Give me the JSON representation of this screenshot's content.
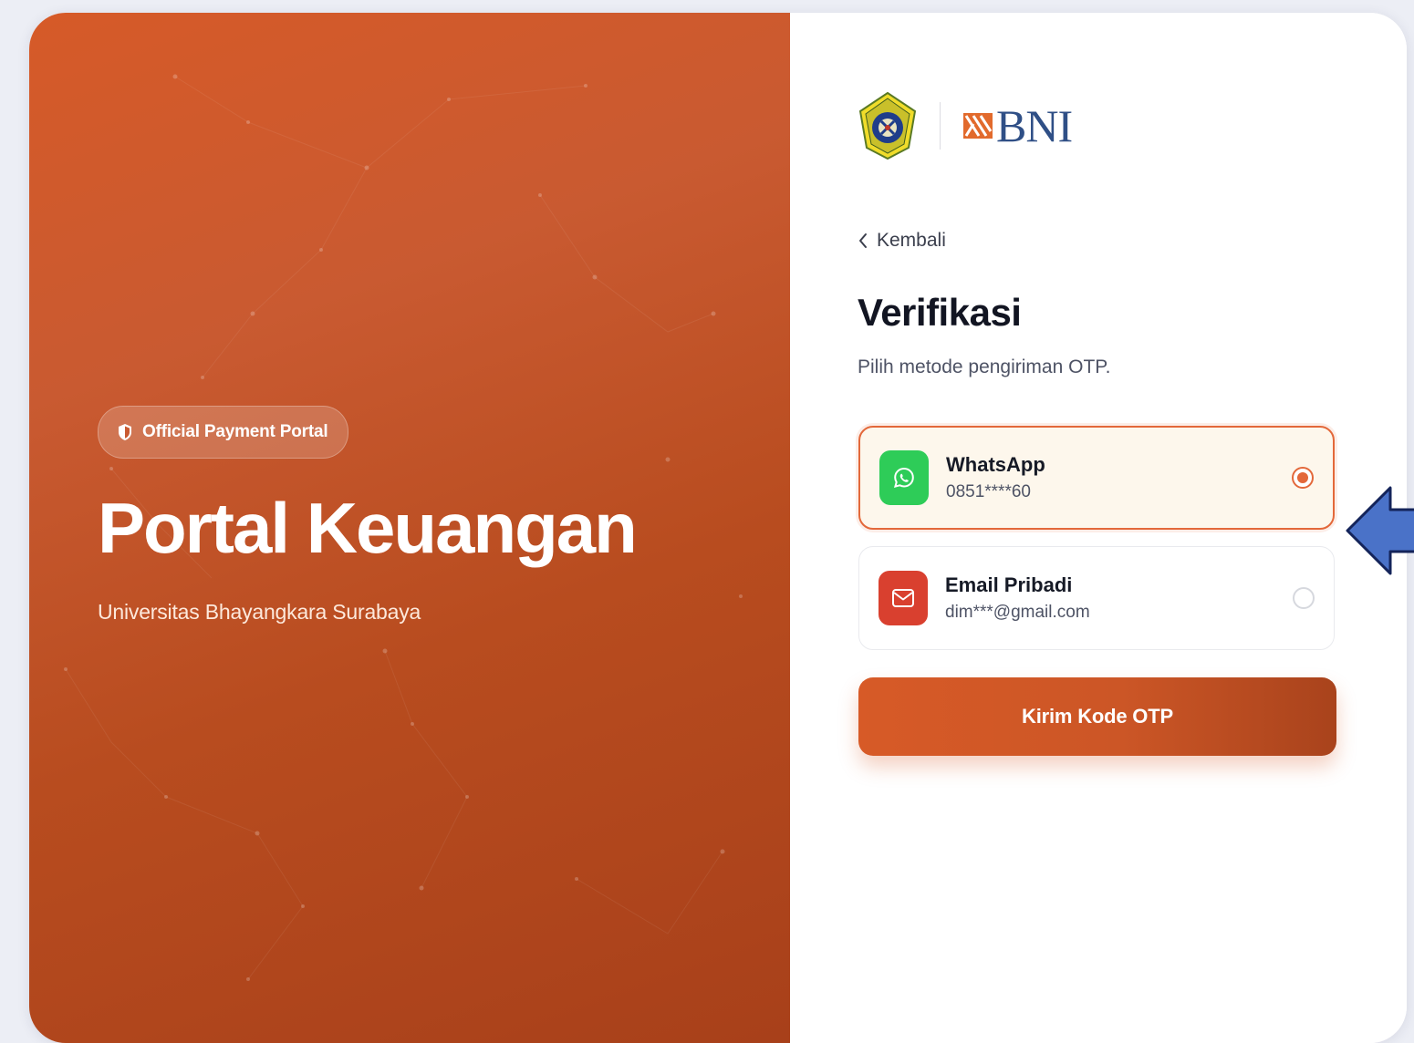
{
  "hero": {
    "badge_label": "Official Payment Portal",
    "badge_icon": "shield-icon",
    "title": "Portal Keuangan",
    "subtitle": "Universitas Bhayangkara Surabaya"
  },
  "brand": {
    "partner_logo_text": "BNI",
    "university_logo": "university-seal-logo"
  },
  "nav": {
    "back_label": "Kembali"
  },
  "form": {
    "title": "Verifikasi",
    "instruction": "Pilih metode pengiriman OTP.",
    "options": [
      {
        "label": "WhatsApp",
        "detail": "0851****60",
        "icon": "whatsapp-icon",
        "selected": true
      },
      {
        "label": "Email Pribadi",
        "detail": "dim***@gmail.com",
        "icon": "mail-icon",
        "selected": false
      }
    ],
    "submit_label": "Kirim Kode OTP"
  },
  "colors": {
    "accent": "#e3683a",
    "hero_gradient_start": "#d65a28",
    "hero_gradient_end": "#a8401a",
    "whatsapp_green": "#2ecc58",
    "email_red": "#d9402f",
    "annotation_arrow": "#4a72c8"
  }
}
